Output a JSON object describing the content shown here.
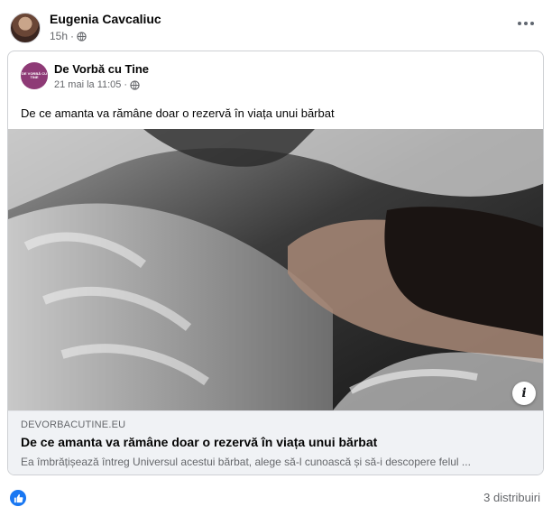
{
  "post": {
    "author": "Eugenia Cavcaliuc",
    "time": "15h",
    "audience_icon": "globe-icon",
    "more_icon": "more-horizontal-icon"
  },
  "shared": {
    "page_name": "De Vorbă cu Tine",
    "page_logo_text": "DE VORBĂ CU TINE",
    "date": "21 mai la 11:05",
    "separator": "·",
    "text": "De ce amanta va rămâne doar o rezervă în viața unui bărbat",
    "photo_alt": "Femeie întinsă pe pat, în lumină și umbre",
    "info_icon": "info-icon"
  },
  "link": {
    "domain": "DEVORBACUTINE.EU",
    "title": "De ce amanta va rămâne doar o rezervă în viața unui bărbat",
    "description": "Ea îmbrățișează întreg Universul acestui bărbat, alege să-l cunoască și să-i descopere felul ..."
  },
  "footer": {
    "reaction_icon": "like-icon",
    "shares": "3 distribuiri"
  },
  "colors": {
    "accent": "#1877f2",
    "text_secondary": "#65676b",
    "page_logo": "#8e3a76",
    "link_bg": "#f0f2f5"
  }
}
